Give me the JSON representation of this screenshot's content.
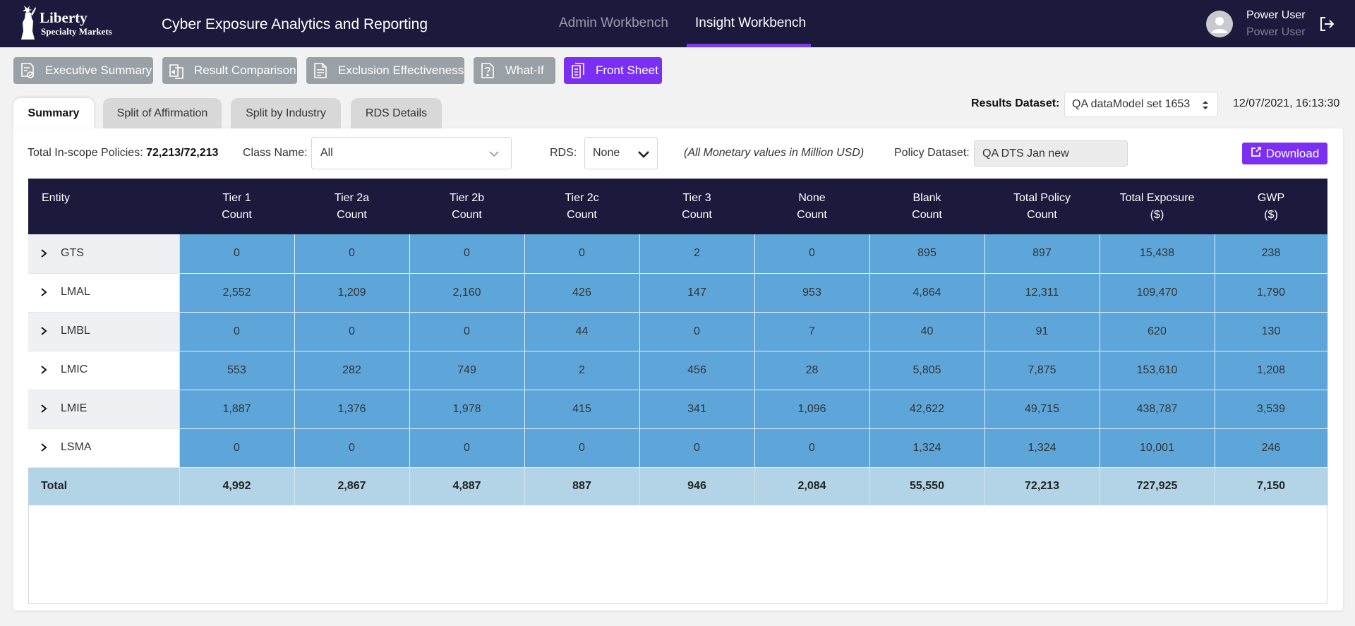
{
  "colors": {
    "header_bg": "#1c1a3c",
    "accent": "#7a2ff2",
    "toolbar_button": "#9aa1a6",
    "cell_blue": "#5ea6da",
    "total_row": "#b3d4e7"
  },
  "header": {
    "logo": {
      "line1": "Liberty",
      "line2": "Specialty Markets",
      "icon": "statue-of-liberty-icon"
    },
    "app_title": "Cyber Exposure Analytics and Reporting",
    "nav": [
      {
        "label": "Admin Workbench",
        "active": false
      },
      {
        "label": "Insight Workbench",
        "active": true
      }
    ],
    "user": {
      "name": "Power User",
      "role": "Power User",
      "avatar_icon": "user-avatar-icon",
      "logout_icon": "logout-icon"
    }
  },
  "toolbar": [
    {
      "label": "Executive Summary",
      "icon": "report-check-icon",
      "active": false
    },
    {
      "label": "Result Comparison",
      "icon": "compare-icon",
      "active": false
    },
    {
      "label": "Exclusion Effectiveness",
      "icon": "document-icon",
      "active": false
    },
    {
      "label": "What-If",
      "icon": "question-doc-icon",
      "active": false
    },
    {
      "label": "Front Sheet",
      "icon": "copy-doc-icon",
      "active": true
    }
  ],
  "tabs": [
    {
      "label": "Summary",
      "active": true
    },
    {
      "label": "Split of Affirmation",
      "active": false
    },
    {
      "label": "Split by Industry",
      "active": false
    },
    {
      "label": "RDS Details",
      "active": false
    }
  ],
  "results_dataset": {
    "label": "Results Dataset:",
    "value": "QA dataModel set 1653",
    "timestamp": "12/07/2021, 16:13:30"
  },
  "filters": {
    "policies_label": "Total In-scope Policies:",
    "policies_value": "72,213/72,213",
    "class_label": "Class Name:",
    "class_value": "All",
    "rds_label": "RDS:",
    "rds_value": "None",
    "note": "(All Monetary values in Million USD)",
    "policy_dataset_label": "Policy Dataset:",
    "policy_dataset_value": "QA DTS Jan new",
    "download_label": "Download"
  },
  "table": {
    "headers": [
      {
        "line1": "Entity",
        "line2": ""
      },
      {
        "line1": "Tier 1",
        "line2": "Count"
      },
      {
        "line1": "Tier 2a",
        "line2": "Count"
      },
      {
        "line1": "Tier 2b",
        "line2": "Count"
      },
      {
        "line1": "Tier 2c",
        "line2": "Count"
      },
      {
        "line1": "Tier 3",
        "line2": "Count"
      },
      {
        "line1": "None",
        "line2": "Count"
      },
      {
        "line1": "Blank",
        "line2": "Count"
      },
      {
        "line1": "Total Policy",
        "line2": "Count"
      },
      {
        "line1": "Total Exposure",
        "line2": "($)"
      },
      {
        "line1": "GWP",
        "line2": "($)"
      }
    ],
    "rows": [
      {
        "entity": "GTS",
        "values": [
          "0",
          "0",
          "0",
          "0",
          "2",
          "0",
          "895",
          "897",
          "15,438",
          "238"
        ]
      },
      {
        "entity": "LMAL",
        "values": [
          "2,552",
          "1,209",
          "2,160",
          "426",
          "147",
          "953",
          "4,864",
          "12,311",
          "109,470",
          "1,790"
        ]
      },
      {
        "entity": "LMBL",
        "values": [
          "0",
          "0",
          "0",
          "44",
          "0",
          "7",
          "40",
          "91",
          "620",
          "130"
        ]
      },
      {
        "entity": "LMIC",
        "values": [
          "553",
          "282",
          "749",
          "2",
          "456",
          "28",
          "5,805",
          "7,875",
          "153,610",
          "1,208"
        ]
      },
      {
        "entity": "LMIE",
        "values": [
          "1,887",
          "1,376",
          "1,978",
          "415",
          "341",
          "1,096",
          "42,622",
          "49,715",
          "438,787",
          "3,539"
        ]
      },
      {
        "entity": "LSMA",
        "values": [
          "0",
          "0",
          "0",
          "0",
          "0",
          "0",
          "1,324",
          "1,324",
          "10,001",
          "246"
        ]
      }
    ],
    "total": {
      "label": "Total",
      "values": [
        "4,992",
        "2,867",
        "4,887",
        "887",
        "946",
        "2,084",
        "55,550",
        "72,213",
        "727,925",
        "7,150"
      ]
    }
  }
}
